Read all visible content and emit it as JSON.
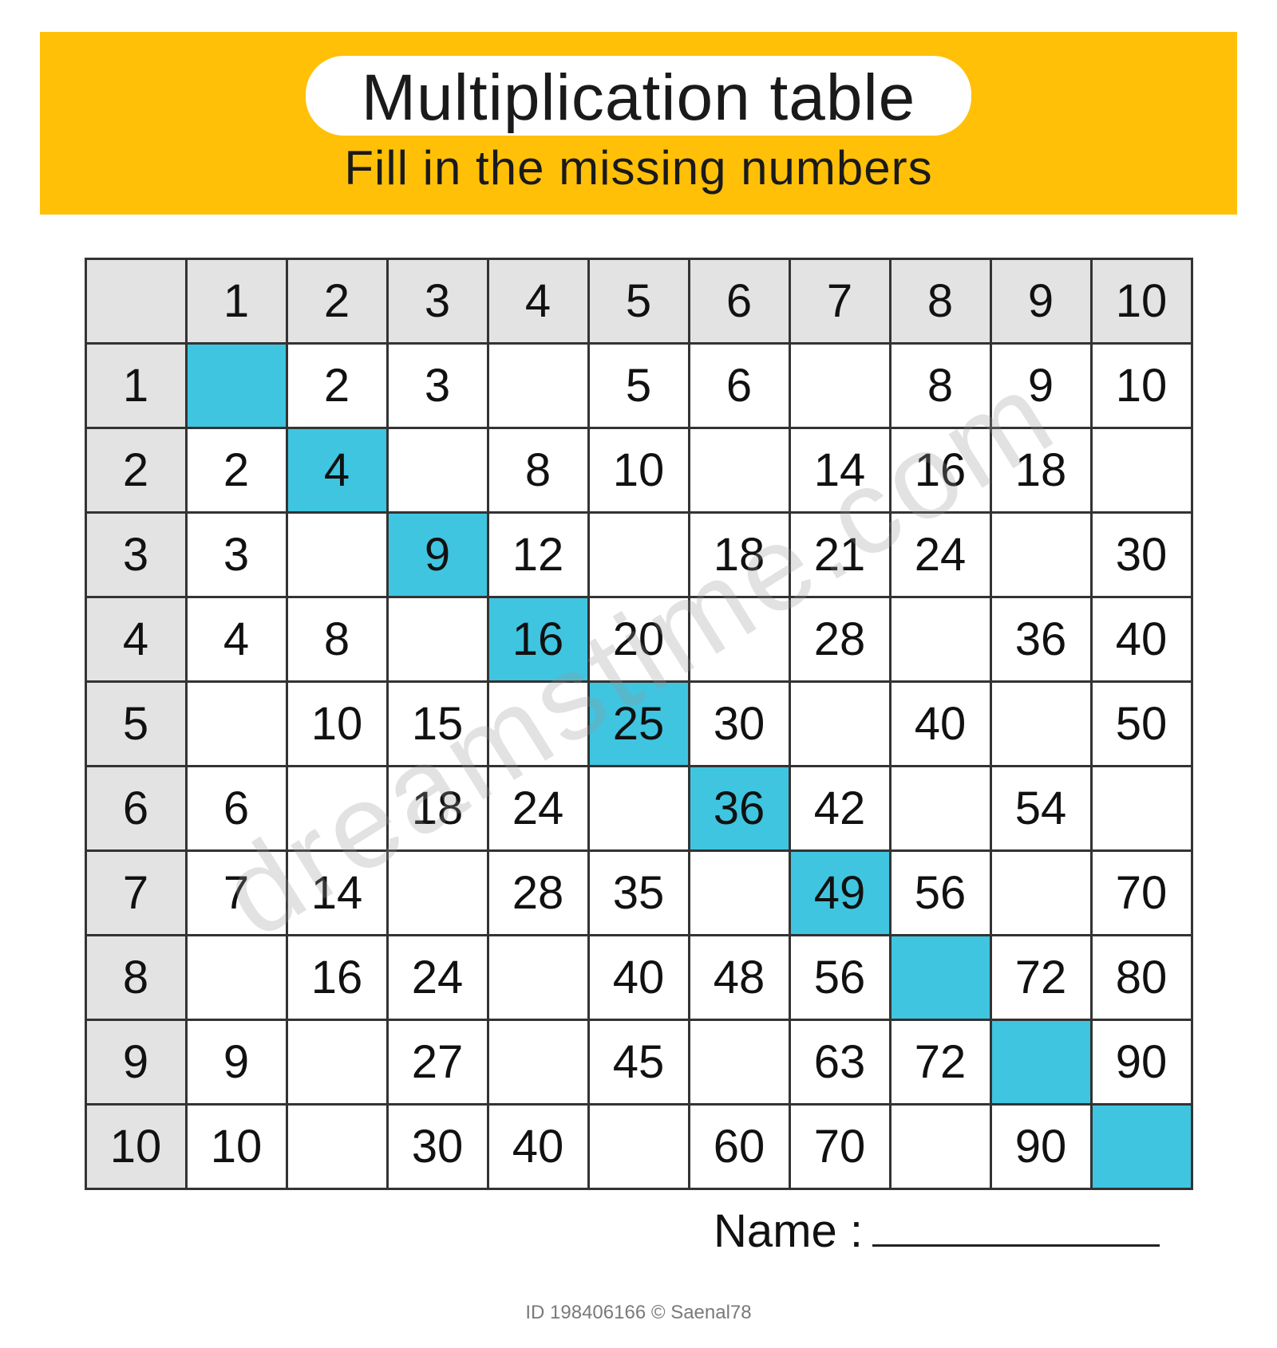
{
  "title": "Multiplication table",
  "subtitle": "Fill in the missing numbers",
  "name_label": "Name :",
  "watermark": "dreamstime.com",
  "footer_id": "ID 198406166 © Saenal78",
  "chart_data": {
    "type": "table",
    "title": "Multiplication table — fill in the missing numbers",
    "column_headers": [
      "1",
      "2",
      "3",
      "4",
      "5",
      "6",
      "7",
      "8",
      "9",
      "10"
    ],
    "row_headers": [
      "1",
      "2",
      "3",
      "4",
      "5",
      "6",
      "7",
      "8",
      "9",
      "10"
    ],
    "diagonal_highlight": true,
    "cells": [
      [
        "",
        "2",
        "3",
        "",
        "5",
        "6",
        "",
        "8",
        "9",
        "10"
      ],
      [
        "2",
        "4",
        "",
        "8",
        "10",
        "",
        "14",
        "16",
        "18",
        ""
      ],
      [
        "3",
        "",
        "9",
        "12",
        "",
        "18",
        "21",
        "24",
        "",
        "30"
      ],
      [
        "4",
        "8",
        "",
        "16",
        "20",
        "",
        "28",
        "",
        "36",
        "40"
      ],
      [
        "",
        "10",
        "15",
        "",
        "25",
        "30",
        "",
        "40",
        "",
        "50"
      ],
      [
        "6",
        "",
        "18",
        "24",
        "",
        "36",
        "42",
        "",
        "54",
        ""
      ],
      [
        "7",
        "14",
        "",
        "28",
        "35",
        "",
        "49",
        "56",
        "",
        "70"
      ],
      [
        "",
        "16",
        "24",
        "",
        "40",
        "48",
        "56",
        "",
        "72",
        "80"
      ],
      [
        "9",
        "",
        "27",
        "",
        "45",
        "",
        "63",
        "72",
        "",
        "90"
      ],
      [
        "10",
        "",
        "30",
        "40",
        "",
        "60",
        "70",
        "",
        "90",
        ""
      ]
    ]
  }
}
